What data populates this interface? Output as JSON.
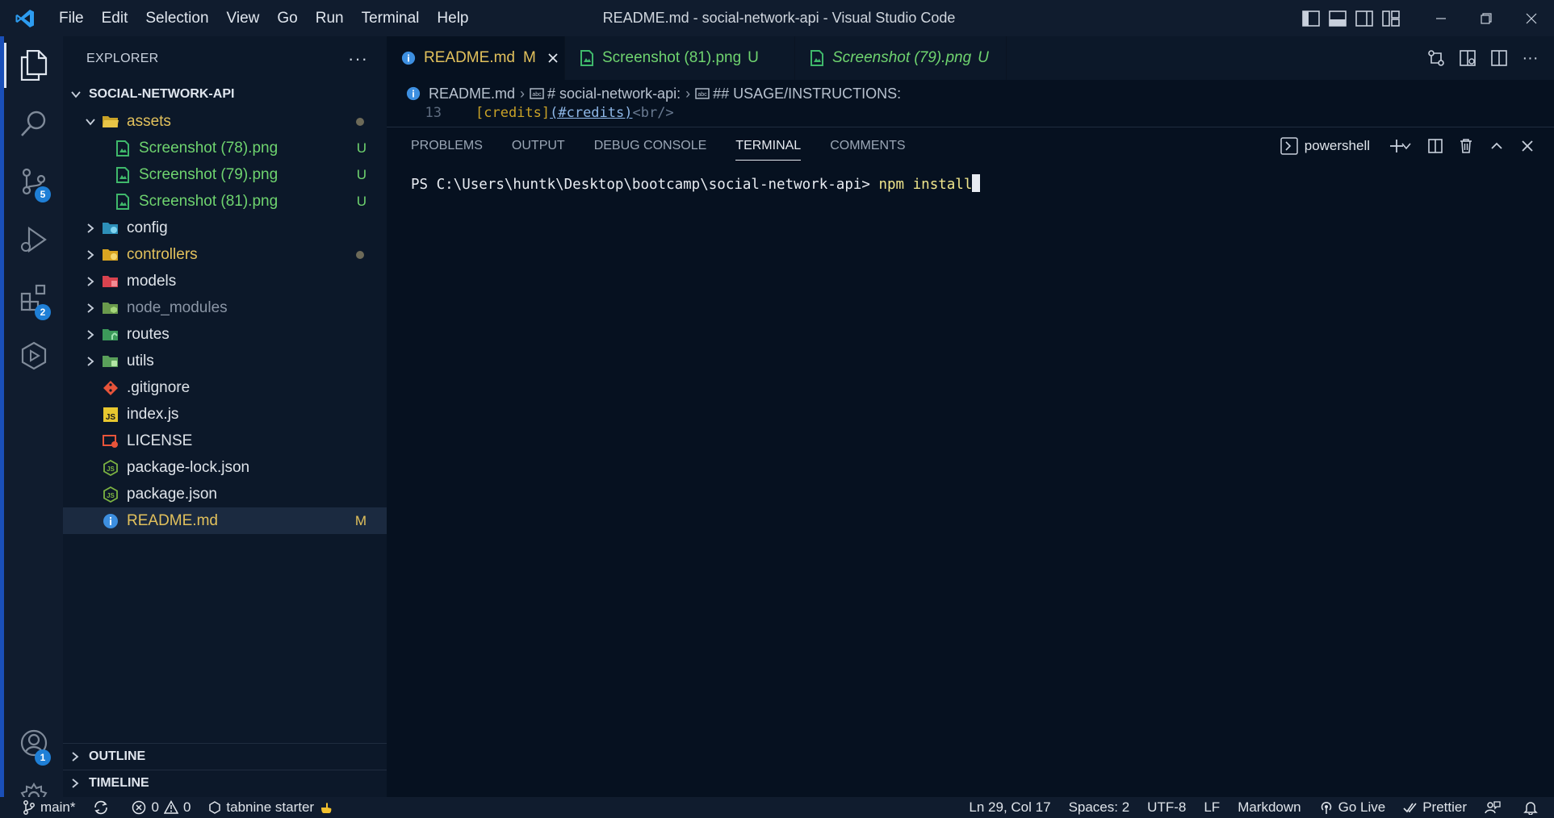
{
  "menu": [
    "File",
    "Edit",
    "Selection",
    "View",
    "Go",
    "Run",
    "Terminal",
    "Help"
  ],
  "window_title": "README.md - social-network-api - Visual Studio Code",
  "activity": {
    "source_control_badge": "5",
    "extensions_badge": "2",
    "accounts_badge": "1"
  },
  "explorer": {
    "title": "EXPLORER",
    "more": "···",
    "root": "SOCIAL-NETWORK-API",
    "assets": {
      "name": "assets",
      "children": [
        {
          "name": "Screenshot (78).png",
          "status": "U"
        },
        {
          "name": "Screenshot (79).png",
          "status": "U"
        },
        {
          "name": "Screenshot (81).png",
          "status": "U"
        }
      ]
    },
    "folders": [
      "config",
      "controllers",
      "models",
      "node_modules",
      "routes",
      "utils"
    ],
    "files": [
      ".gitignore",
      "index.js",
      "LICENSE",
      "package-lock.json",
      "package.json"
    ],
    "readme": {
      "name": "README.md",
      "status": "M"
    },
    "outline": "OUTLINE",
    "timeline": "TIMELINE"
  },
  "tabs": [
    {
      "label": "README.md",
      "status": "M"
    },
    {
      "label": "Screenshot (81).png",
      "status": "U"
    },
    {
      "label": "Screenshot (79).png",
      "status": "U"
    }
  ],
  "breadcrumb": [
    "README.md",
    "# social-network-api:",
    "## USAGE/INSTRUCTIONS:"
  ],
  "code": {
    "line_number": "13",
    "open": "[credits]",
    "link": "(#credits)",
    "tag": "<br/>"
  },
  "panel": {
    "tabs": [
      "PROBLEMS",
      "OUTPUT",
      "DEBUG CONSOLE",
      "TERMINAL",
      "COMMENTS"
    ],
    "active_tab": "TERMINAL",
    "shell": "powershell",
    "prompt": "PS C:\\Users\\huntk\\Desktop\\bootcamp\\social-network-api> ",
    "command": "npm install"
  },
  "status": {
    "branch": "main*",
    "errors": "0",
    "warnings": "0",
    "tabnine": "tabnine starter",
    "position": "Ln 29, Col 17",
    "spaces": "Spaces: 2",
    "encoding": "UTF-8",
    "eol": "LF",
    "language": "Markdown",
    "golive": "Go Live",
    "prettier": "Prettier"
  },
  "colors": {
    "accent_blue": "#1f7fd6",
    "untracked_green": "#6fd46f",
    "modified_yellow": "#e2c15c"
  }
}
